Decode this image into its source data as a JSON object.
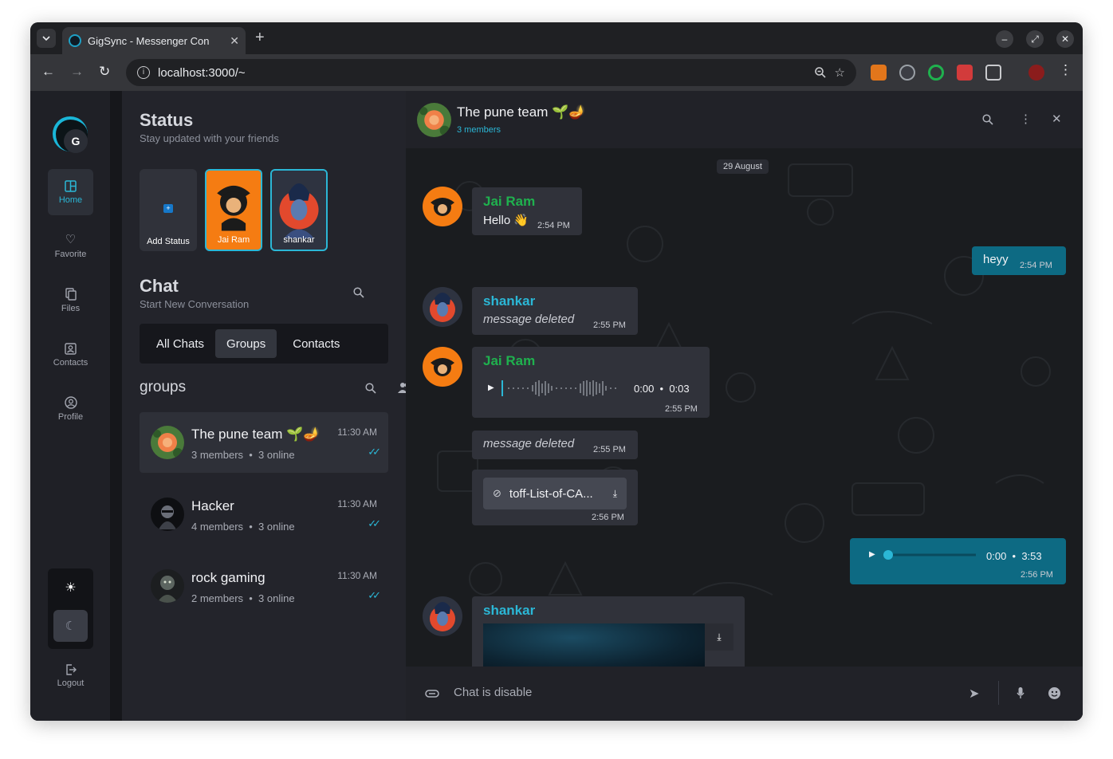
{
  "browser": {
    "tab_title": "GigSync - Messenger Con",
    "url": "localhost:3000/~",
    "new_tab": "+",
    "tab_close": "✕"
  },
  "nav": {
    "logo_letter": "G",
    "items": [
      {
        "label": "Home",
        "icon": "home-icon",
        "active": true
      },
      {
        "label": "Favorite",
        "icon": "heart-icon"
      },
      {
        "label": "Files",
        "icon": "files-icon"
      },
      {
        "label": "Contacts",
        "icon": "contacts-icon"
      },
      {
        "label": "Profile",
        "icon": "profile-icon"
      }
    ],
    "logout": "Logout"
  },
  "status": {
    "title": "Status",
    "subtitle": "Stay updated with your friends",
    "cards": [
      {
        "label": "Add Status"
      },
      {
        "label": "Jai Ram"
      },
      {
        "label": "shankar"
      }
    ]
  },
  "chat_section": {
    "title": "Chat",
    "subtitle": "Start New Conversation",
    "tabs": [
      "All Chats",
      "Groups",
      "Contacts"
    ],
    "active_tab": "Groups"
  },
  "groups": {
    "title": "groups",
    "items": [
      {
        "name": "The pune team 🌱🪔",
        "members": "3 members",
        "online": "3 online",
        "time": "11:30 AM",
        "active": true
      },
      {
        "name": "Hacker",
        "members": "4 members",
        "online": "3 online",
        "time": "11:30 AM"
      },
      {
        "name": "rock gaming",
        "members": "2 members",
        "online": "3 online",
        "time": "11:30 AM"
      }
    ]
  },
  "conversation": {
    "title": "The pune team 🌱🪔",
    "subtitle": "3 members",
    "date": "29 August",
    "messages": [
      {
        "sender": "Jai Ram",
        "text": "Hello 👋",
        "time": "2:54 PM"
      },
      {
        "sender": "me",
        "text": "heyy",
        "time": "2:54 PM"
      },
      {
        "sender": "shankar",
        "text": "message deleted",
        "time": "2:55 PM"
      },
      {
        "sender": "Jai Ram",
        "type": "voice",
        "current": "0:00",
        "duration": "0:03",
        "time": "2:55 PM"
      },
      {
        "sender": "Jai Ram",
        "text": "message deleted",
        "time": "2:55 PM"
      },
      {
        "sender": "Jai Ram",
        "type": "file",
        "filename": "toff-List-of-CA...",
        "time": "2:56 PM"
      },
      {
        "sender": "me",
        "type": "audio",
        "current": "0:00",
        "duration": "3:53",
        "time": "2:56 PM"
      },
      {
        "sender": "shankar",
        "type": "image"
      }
    ],
    "composer_placeholder": "Chat is disable"
  },
  "colors": {
    "accent": "#2bb7d6",
    "sender_green": "#1fb14e",
    "outgoing_bubble": "#0d6a83"
  }
}
